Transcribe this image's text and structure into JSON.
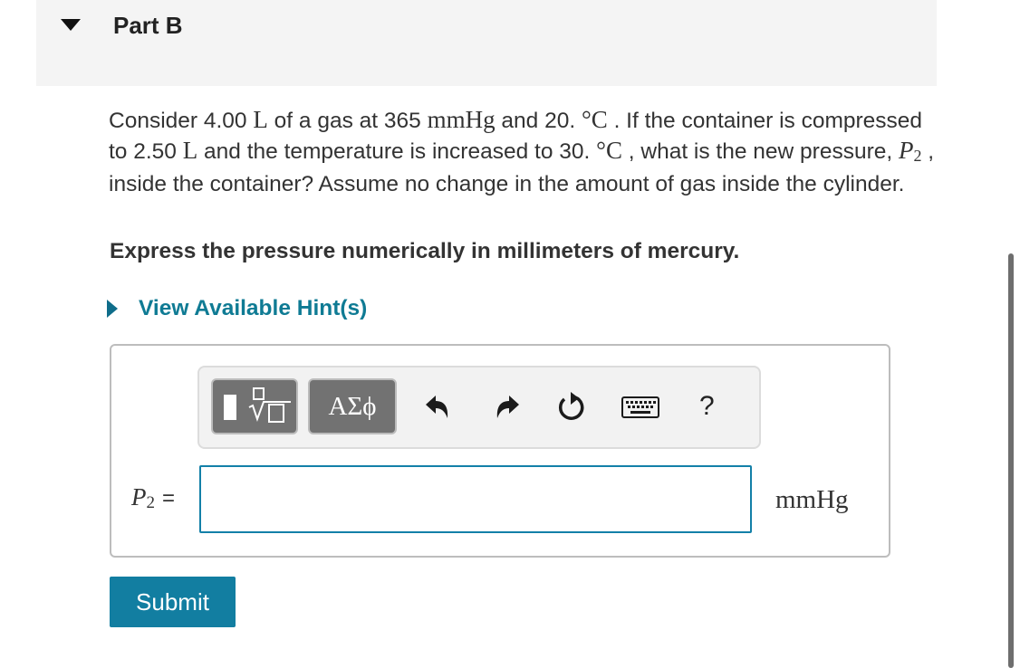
{
  "part": {
    "title": "Part B"
  },
  "question": {
    "t1": "Consider 4.00 ",
    "m1": "L",
    "t2": " of a gas at 365 ",
    "m2": "mmHg",
    "t3": " and 20. ",
    "m3": "°C",
    "t4": " . If the container is compressed to 2.50 ",
    "m4": "L",
    "t5": " and the temperature is increased to 30. ",
    "m5": "°C",
    "t6": " , what is the new pressure, ",
    "m6": "P",
    "m6sub": "2",
    "t7": " , inside the container? Assume no change in the amount of gas inside the cylinder."
  },
  "instruction": "Express the pressure numerically in millimeters of mercury.",
  "hint": {
    "label": "View Available Hint(s)"
  },
  "toolbar": {
    "templates_icon": "templates-icon",
    "greek_label": "ΑΣϕ",
    "undo_icon": "undo-icon",
    "redo_icon": "redo-icon",
    "reset_icon": "reset-icon",
    "keyboard_icon": "keyboard-icon",
    "help_label": "?"
  },
  "answer": {
    "variable": "P",
    "variable_sub": "2",
    "equals": "=",
    "value": "",
    "unit": "mmHg"
  },
  "submit": {
    "label": "Submit"
  },
  "colors": {
    "accent": "#127ea1",
    "link": "#0f7b94",
    "header_bg": "#f4f4f4"
  }
}
